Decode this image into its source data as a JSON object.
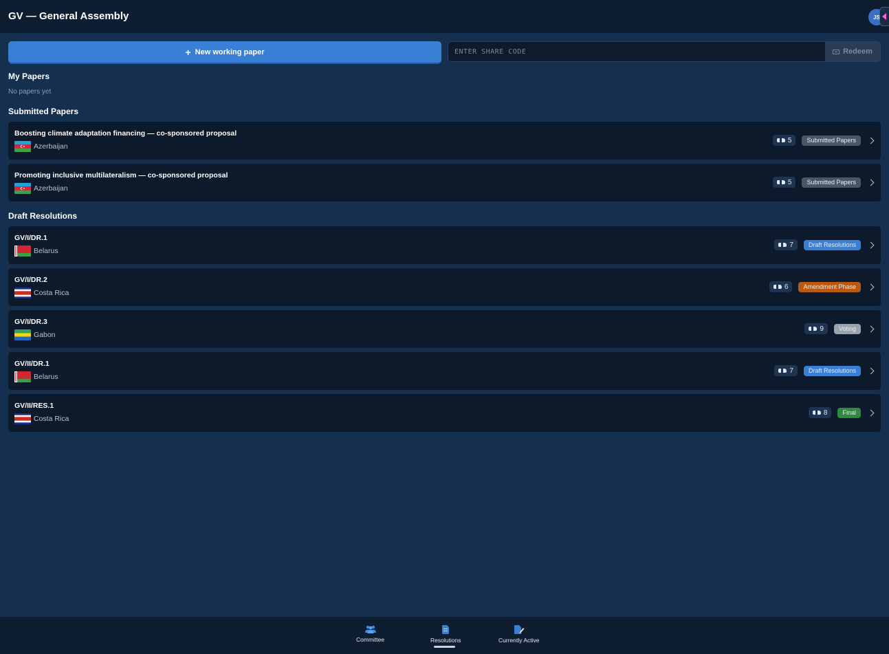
{
  "header": {
    "title": "GV — General Assembly",
    "avatar_initials": "JS"
  },
  "actions": {
    "new_paper_label": "New working paper",
    "share_code_placeholder": "ENTER SHARE CODE",
    "redeem_label": "Redeem"
  },
  "sections": {
    "my_papers": {
      "title": "My Papers",
      "empty_text": "No papers yet"
    },
    "submitted": {
      "title": "Submitted Papers",
      "items": [
        {
          "title": "Boosting climate adaptation financing — co-sponsored proposal",
          "country": "Azerbaijan",
          "count": "5",
          "status": "Submitted Papers"
        },
        {
          "title": "Promoting inclusive multilateralism — co-sponsored proposal",
          "country": "Azerbaijan",
          "count": "5",
          "status": "Submitted Papers"
        }
      ]
    },
    "drafts": {
      "title": "Draft Resolutions",
      "items": [
        {
          "title": "GV/I/DR.1",
          "country": "Belarus",
          "count": "7",
          "status": "Draft Resolutions"
        },
        {
          "title": "GV/I/DR.2",
          "country": "Costa Rica",
          "count": "6",
          "status": "Amendment Phase"
        },
        {
          "title": "GV/I/DR.3",
          "country": "Gabon",
          "count": "9",
          "status": "Voting"
        },
        {
          "title": "GV/II/DR.1",
          "country": "Belarus",
          "count": "7",
          "status": "Draft Resolutions"
        },
        {
          "title": "GV/II/RES.1",
          "country": "Costa Rica",
          "count": "8",
          "status": "Final"
        }
      ]
    }
  },
  "status_colors": {
    "Submitted Papers": "#4a5668",
    "Draft Resolutions": "#3a7fd6",
    "Amendment Phase": "#b85a14",
    "Voting": "#9aa3ad",
    "Final": "#2e8a3e"
  },
  "bottom_nav": {
    "items": [
      {
        "label": "Committee",
        "icon": "people-icon"
      },
      {
        "label": "Resolutions",
        "icon": "document-icon",
        "active": true
      },
      {
        "label": "Currently Active",
        "icon": "edit-document-icon"
      }
    ]
  }
}
